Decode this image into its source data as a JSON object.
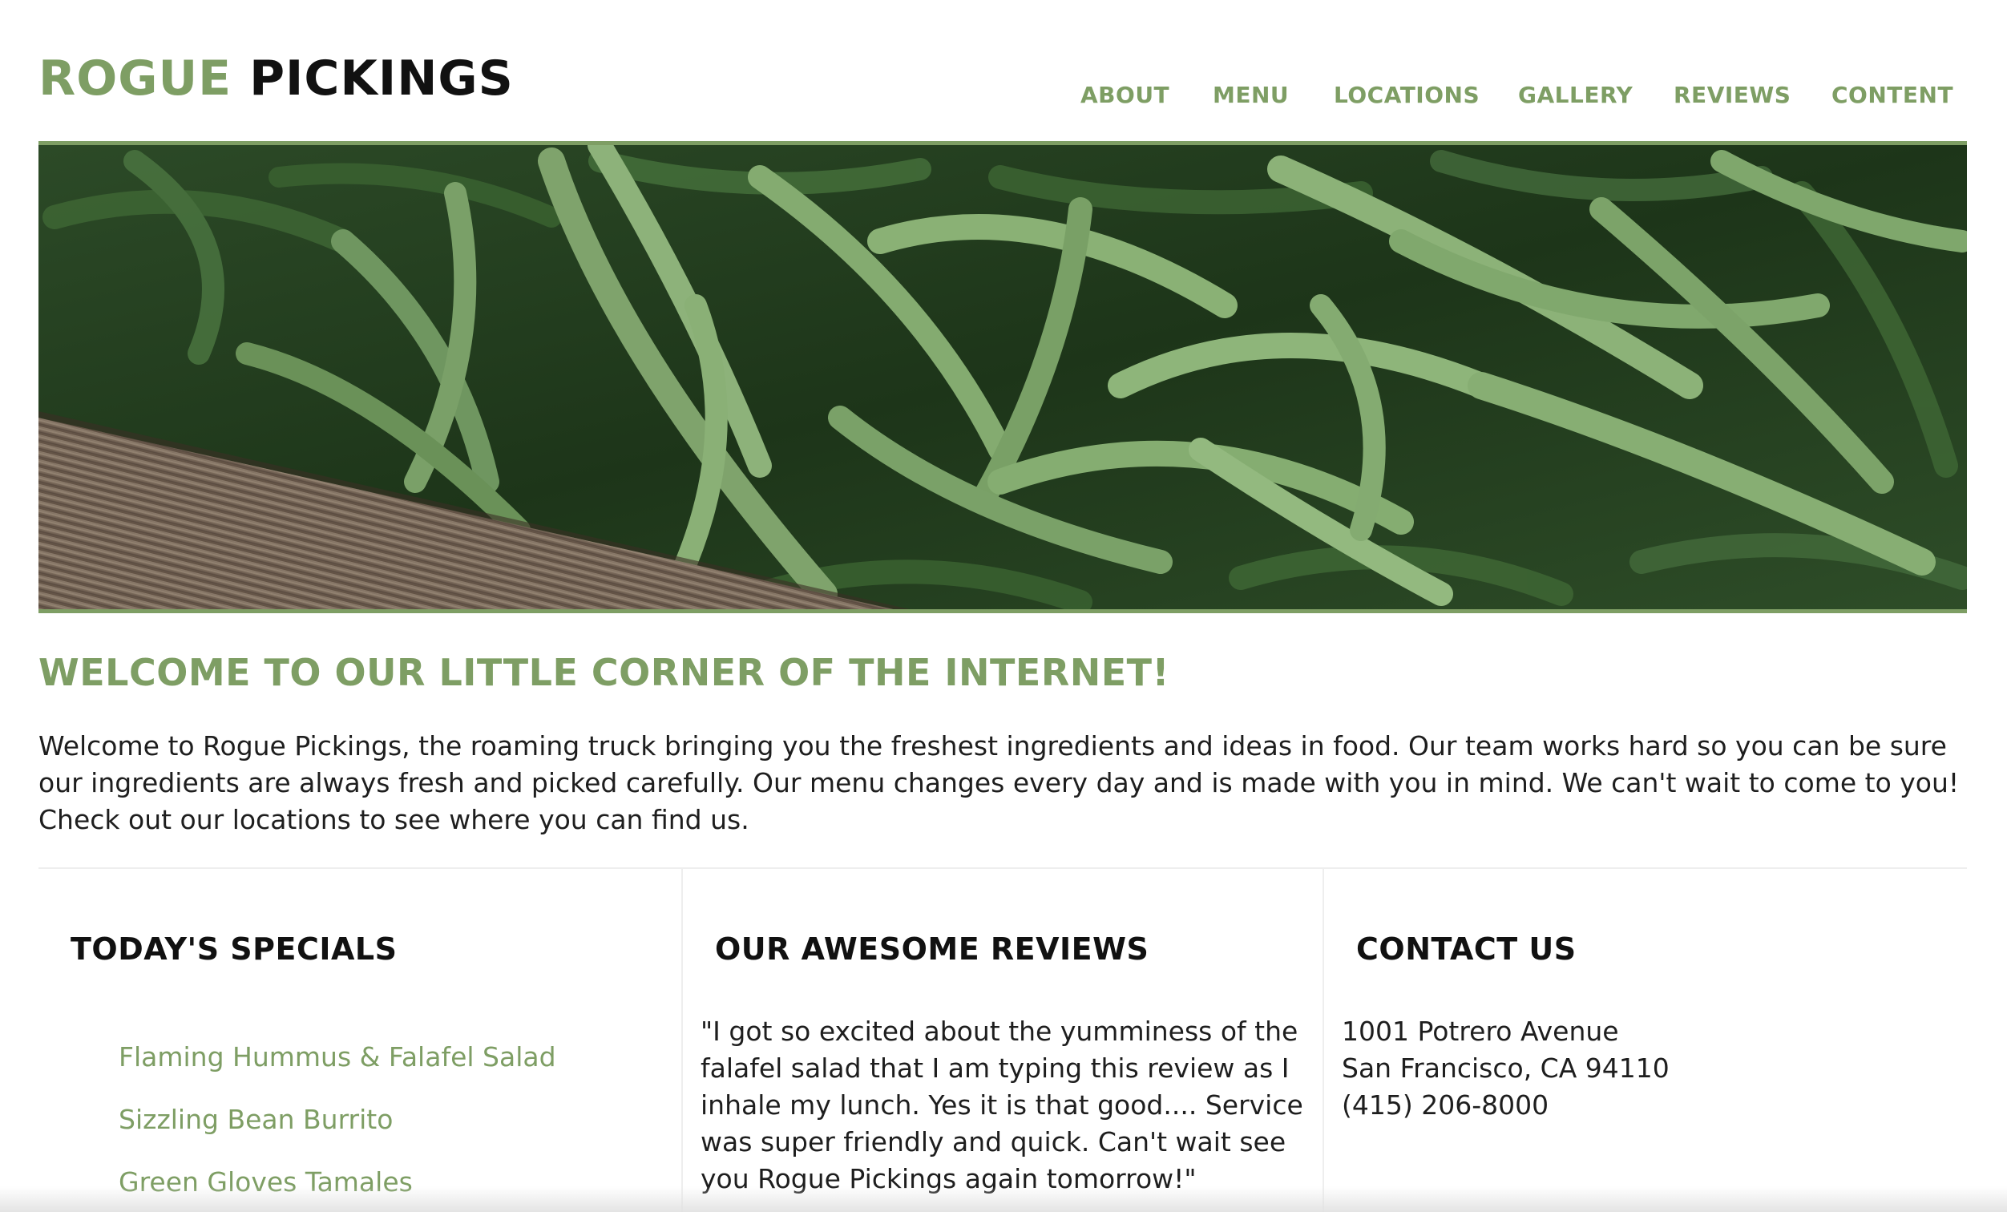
{
  "brand": {
    "part1": "ROGUE",
    "part2": "PICKINGS",
    "accent_color": "#7e9e64",
    "dark_color": "#111111"
  },
  "nav": {
    "items": [
      {
        "label": "ABOUT"
      },
      {
        "label": "MENU"
      },
      {
        "label": "LOCATIONS"
      },
      {
        "label": "GALLERY"
      },
      {
        "label": "REVIEWS"
      },
      {
        "label": "CONTENT"
      }
    ]
  },
  "hero": {
    "image": "green-beans-photo"
  },
  "welcome": {
    "title": "WELCOME TO OUR LITTLE CORNER OF THE INTERNET!",
    "body": "Welcome to Rogue Pickings, the roaming truck bringing you the freshest ingredients and ideas in food. Our team works hard so you can be sure our ingredients are always fresh and picked carefully. Our menu changes every day and is made with you in mind. We can't wait to come to you! Check out our locations to see where you can find us."
  },
  "specials": {
    "title": "TODAY'S SPECIALS",
    "items": [
      {
        "label": "Flaming Hummus & Falafel Salad"
      },
      {
        "label": "Sizzling Bean Burrito"
      },
      {
        "label": "Green Gloves Tamales"
      }
    ]
  },
  "reviews": {
    "title": "OUR AWESOME REVIEWS",
    "text": "\"I got so excited about the yumminess of the falafel salad that I am typing this review as I inhale my lunch. Yes it is that good.... Service was super friendly and quick. Can't wait see you Rogue Pickings again tomorrow!\""
  },
  "contact": {
    "title": "CONTACT US",
    "address_line1": "1001 Potrero Avenue",
    "address_line2": "San Francisco, CA 94110",
    "phone": "(415) 206-8000"
  }
}
